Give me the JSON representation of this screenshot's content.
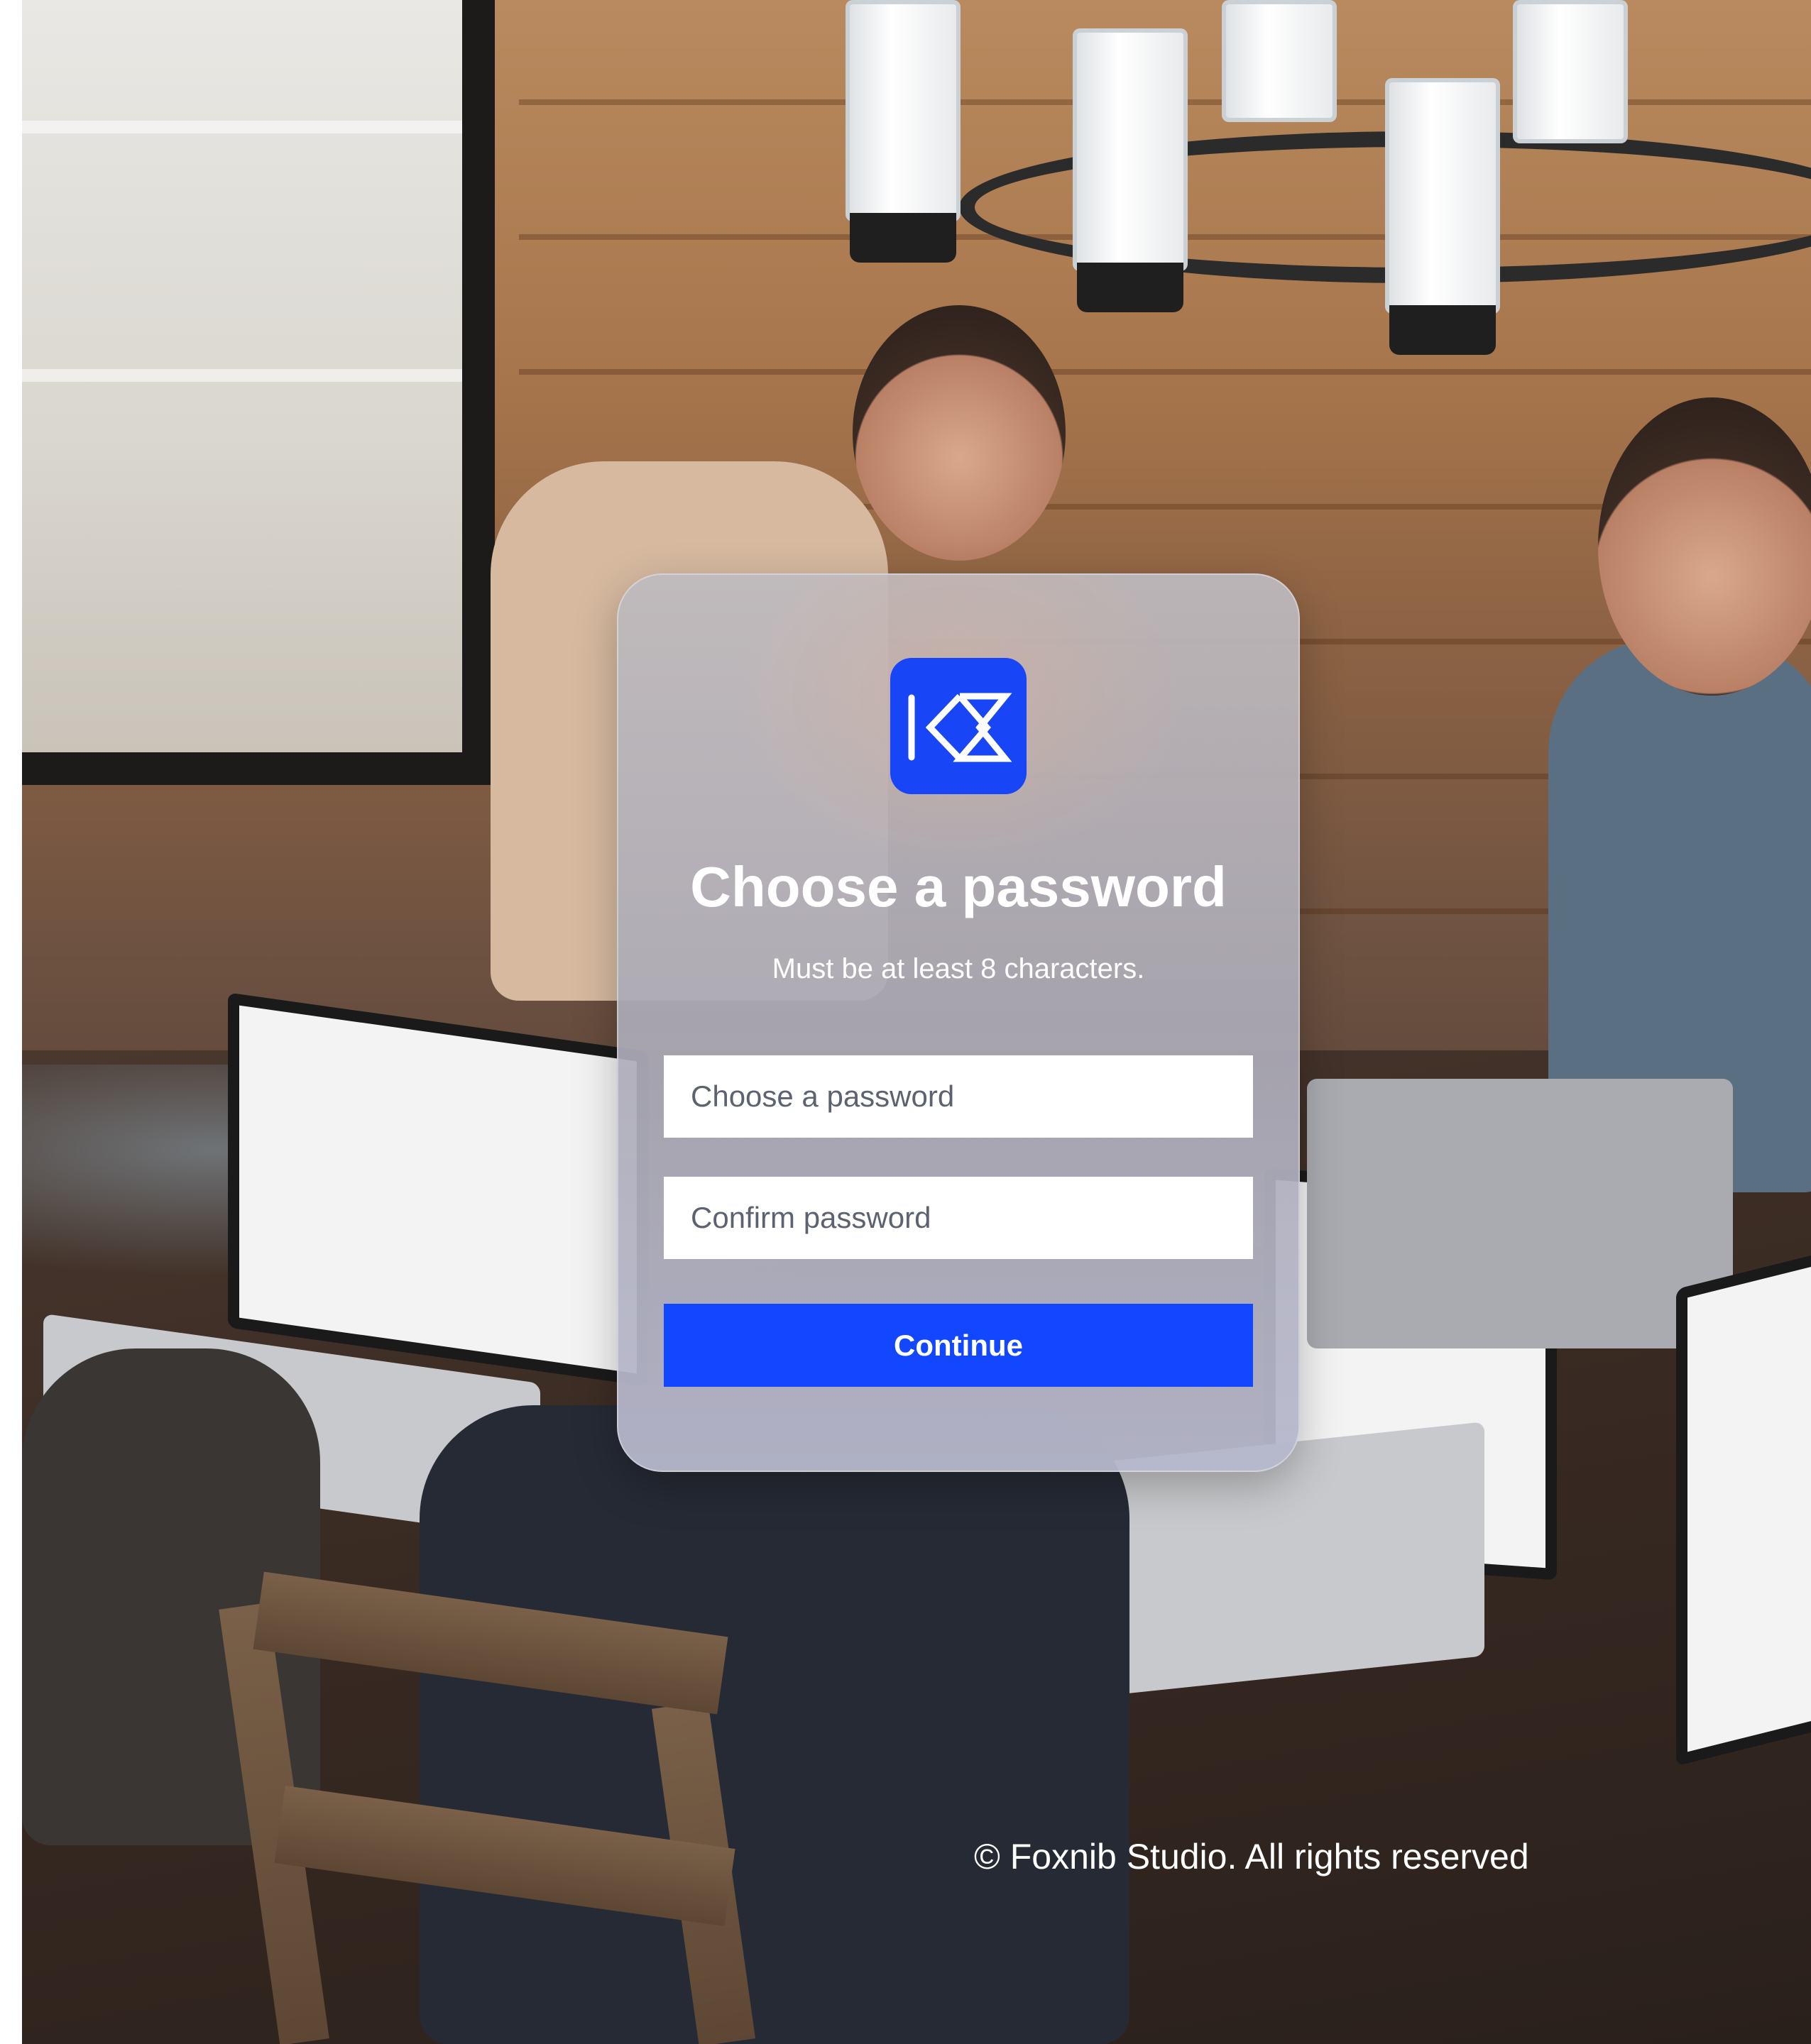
{
  "brand": {
    "logo_icon": "k-chevron-logo-icon",
    "accent_color": "#1246FF",
    "logo_bg_color": "#1845F5"
  },
  "card": {
    "title": "Choose a password",
    "subtitle": "Must be at least 8 characters."
  },
  "form": {
    "password": {
      "placeholder": "Choose a password",
      "value": ""
    },
    "confirm_password": {
      "placeholder": "Confirm password",
      "value": ""
    },
    "continue_label": "Continue"
  },
  "footer": {
    "copyright": "© Foxnib Studio. All rights reserved"
  }
}
